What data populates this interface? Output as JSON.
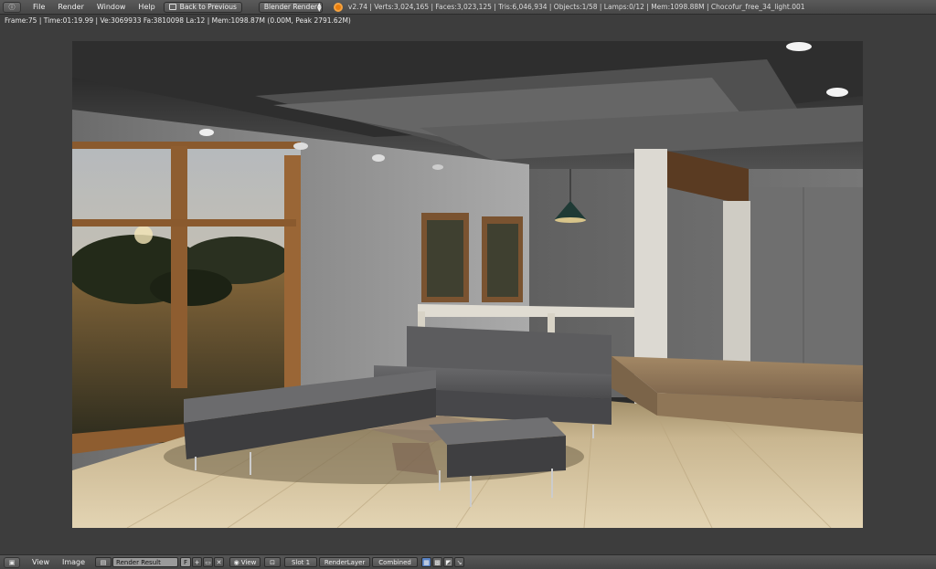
{
  "topbar": {
    "editor_icon": "info-icon",
    "menus": [
      "File",
      "Render",
      "Window",
      "Help"
    ],
    "back_button": "Back to Previous",
    "render_engine": "Blender Render",
    "stats": "v2.74 | Verts:3,024,165 | Faces:3,023,125 | Tris:6,046,934 | Objects:1/58 | Lamps:0/12 | Mem:1098.88M | Chocofur_free_34_light.001"
  },
  "render_status": "Frame:75 | Time:01:19.99 | Ve:3069933 Fa:3810098 La:12 | Mem:1098.87M (0.00M, Peak 2791.62M)",
  "render_image": {
    "description_icon": "rendered-living-room-image"
  },
  "bottombar": {
    "editor_icon": "image-editor-icon",
    "menus": [
      "View",
      "Image"
    ],
    "image_browse_icon": "image-browse-icon",
    "image_name": "Render Result",
    "fake_user": "F",
    "view_menu": "View",
    "slot": "Slot 1",
    "layer": "RenderLayer",
    "pass": "Combined"
  },
  "colors": {
    "ui_bg": "#3d3d3d",
    "header_bg": "#4a4a4a",
    "active_blue": "#5680c2",
    "blender_orange": "#e87d0d"
  }
}
